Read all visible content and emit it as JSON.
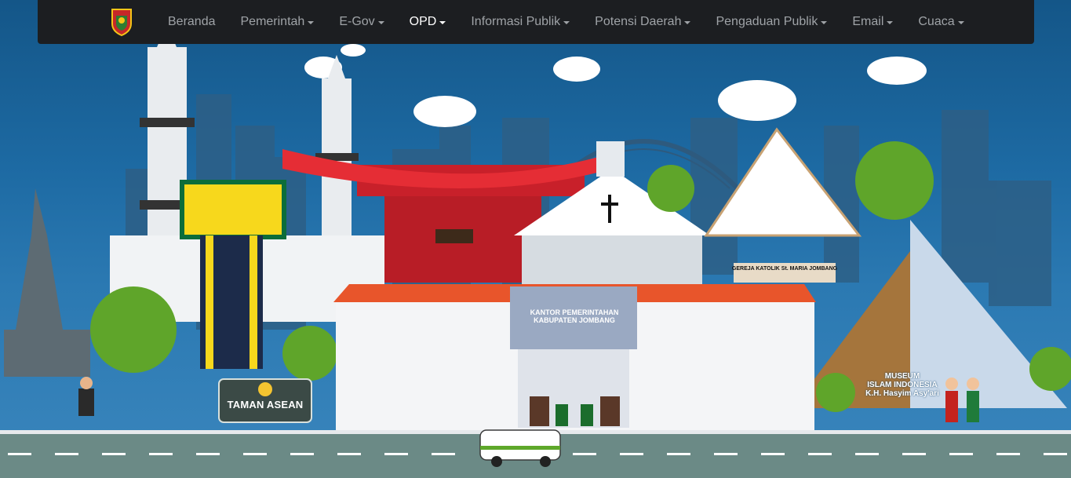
{
  "navbar": {
    "logo_icon": "jombang-crest-icon",
    "items": [
      {
        "label": "Beranda",
        "dropdown": false,
        "active": false
      },
      {
        "label": "Pemerintah",
        "dropdown": true,
        "active": false
      },
      {
        "label": "E-Gov",
        "dropdown": true,
        "active": false
      },
      {
        "label": "OPD",
        "dropdown": true,
        "active": true
      },
      {
        "label": "Informasi Publik",
        "dropdown": true,
        "active": false
      },
      {
        "label": "Potensi Daerah",
        "dropdown": true,
        "active": false
      },
      {
        "label": "Pengaduan Publik",
        "dropdown": true,
        "active": false
      },
      {
        "label": "Email",
        "dropdown": true,
        "active": false
      },
      {
        "label": "Cuaca",
        "dropdown": true,
        "active": false
      }
    ]
  },
  "hero": {
    "sign": "TAMAN ASEAN",
    "office": [
      "KANTOR PEMERINTAHAN",
      "KABUPATEN JOMBANG"
    ],
    "church": "GEREJA KATOLIK St. MARIA JOMBANG",
    "museum": [
      "MUSEUM",
      "ISLAM INDONESIA",
      "K.H. Hasyim Asy'ari"
    ]
  },
  "colors": {
    "navbar_bg": "#1c1e21",
    "nav_text": "#9fa3a7",
    "nav_active": "#ffffff",
    "sky": "#1d6aa3",
    "road": "#6b8a86",
    "roof": "#e8552b"
  }
}
